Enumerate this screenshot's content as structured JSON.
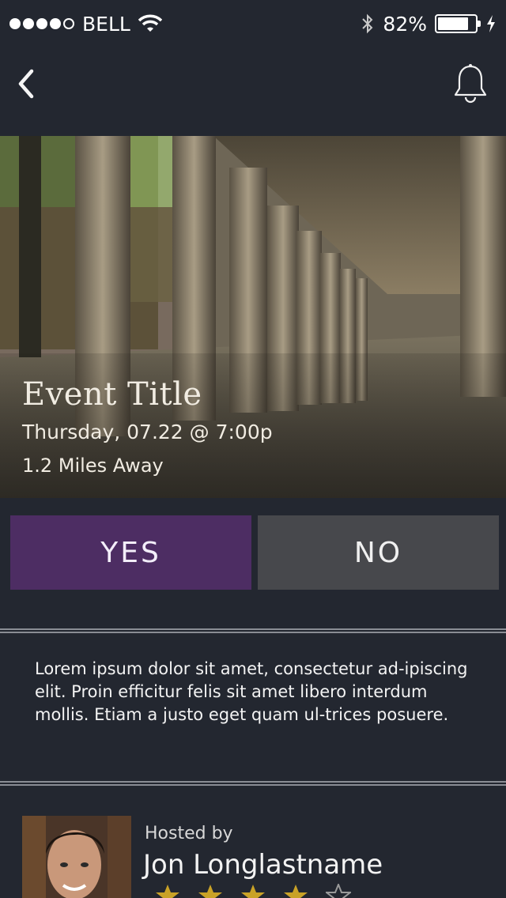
{
  "status_bar": {
    "carrier": "BELL",
    "battery": "82%",
    "battery_level": 0.82,
    "signal_bars_filled": 4,
    "signal_bars_total": 5
  },
  "nav": {
    "back_icon": "chevron-left-icon",
    "notification_icon": "bell-icon"
  },
  "event": {
    "title": "Event Title",
    "datetime": "Thursday, 07.22 @ 7:00p",
    "distance": "1.2 Miles Away"
  },
  "rsvp": {
    "yes_label": "YES",
    "no_label": "NO",
    "yes_color": "#4d2d63",
    "no_color": "#47484c"
  },
  "description": "Lorem ipsum dolor sit amet, consectetur ad-ipiscing elit. Proin efficitur felis sit amet libero interdum mollis. Etiam a justo eget quam ul-trices posuere.",
  "host": {
    "hosted_by_label": "Hosted by",
    "name": "Jon Longlastname",
    "rating": 4,
    "rating_max": 5,
    "star_color": "#c9a227"
  }
}
